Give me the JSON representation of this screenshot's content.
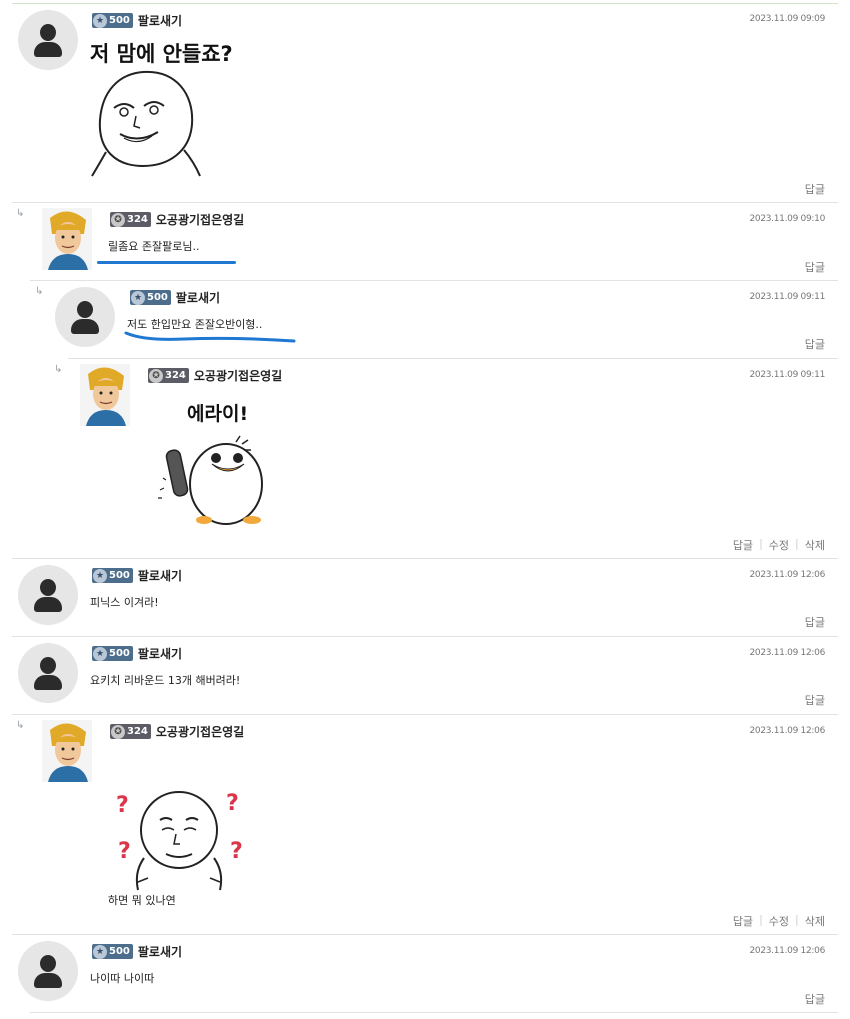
{
  "comments": [
    {
      "nick": "팔로새기",
      "level": "500",
      "date": "2023.11.09 09:09",
      "sticker_text": "저 맘에 안들죠?",
      "actions": [
        "답글"
      ]
    },
    {
      "nick": "오공광기접은영길",
      "level": "324",
      "date": "2023.11.09 09:10",
      "text": "릴좀요 존잘팔로님..",
      "actions": [
        "답글"
      ]
    },
    {
      "nick": "팔로새기",
      "level": "500",
      "date": "2023.11.09 09:11",
      "text": "저도 한입만요 존잘오반이형..",
      "actions": [
        "답글"
      ]
    },
    {
      "nick": "오공광기접은영길",
      "level": "324",
      "date": "2023.11.09 09:11",
      "sticker_text": "에라이!",
      "actions": [
        "답글",
        "수정",
        "삭제"
      ]
    },
    {
      "nick": "팔로새기",
      "level": "500",
      "date": "2023.11.09 12:06",
      "text": "피닉스 이겨라!",
      "actions": [
        "답글"
      ]
    },
    {
      "nick": "팔로새기",
      "level": "500",
      "date": "2023.11.09 12:06",
      "text": "요키치 리바운드 13개 해버려라!",
      "actions": [
        "답글"
      ]
    },
    {
      "nick": "오공광기접은영길",
      "level": "324",
      "date": "2023.11.09 12:06",
      "sticker_text": "하면 뭐 있나연",
      "actions": [
        "답글",
        "수정",
        "삭제"
      ]
    },
    {
      "nick": "팔로새기",
      "level": "500",
      "date": "2023.11.09 12:06",
      "text": "나이따 나이따",
      "actions": [
        "답글"
      ]
    }
  ],
  "reply_arrow": "↳"
}
